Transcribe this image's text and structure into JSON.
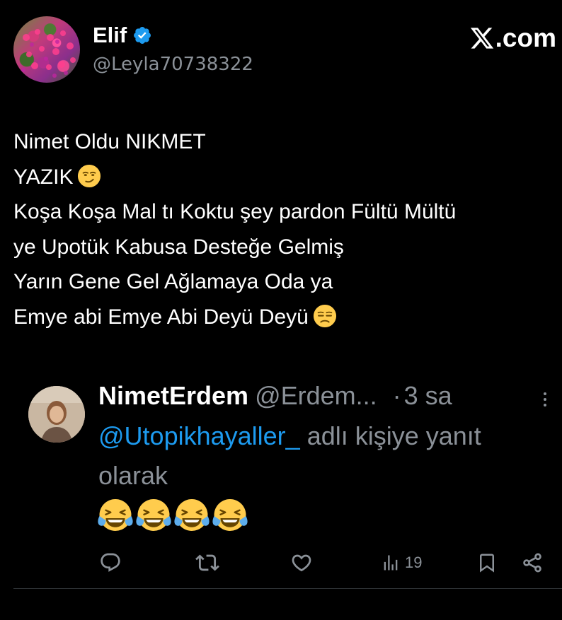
{
  "author": {
    "display_name": "Elif",
    "handle": "@Leyla70738322",
    "verified": true
  },
  "brand": {
    "label": ".com",
    "icon": "x-logo-icon"
  },
  "tweet": {
    "lines": [
      "Nimet Oldu NIKMET",
      "YAZIK",
      "Koşa Koşa Mal tı Koktu şey pardon Fültü Mültü",
      "ye Upotük Kabusa Desteğe Gelmiş",
      "Yarın Gene Gel Ağlamaya Oda ya",
      "Emye abi Emye Abi Deyü Deyü"
    ],
    "emojis": {
      "line2": "smirking-face",
      "line6": "unamused-face"
    }
  },
  "reply": {
    "display_name": "NimetErdem",
    "handle": "@Erdem...",
    "dot": "·",
    "time": "3 sa",
    "mention": "@Utopikhayaller_",
    "context_text": " adlı kişiye yanıt olarak",
    "emojis": [
      "face-with-tears-of-joy",
      "face-with-tears-of-joy",
      "face-with-tears-of-joy",
      "face-with-tears-of-joy"
    ]
  },
  "actions": {
    "reply_icon": "comment-icon",
    "retweet_icon": "retweet-icon",
    "like_icon": "heart-icon",
    "views_icon": "views-chart-icon",
    "views_count": "19",
    "bookmark_icon": "bookmark-icon",
    "share_icon": "share-icon"
  },
  "colors": {
    "background": "#000000",
    "text": "#ffffff",
    "muted": "#8b9198",
    "link": "#1d9bf0",
    "verified": "#1d9bf0",
    "divider": "#2f3336"
  }
}
